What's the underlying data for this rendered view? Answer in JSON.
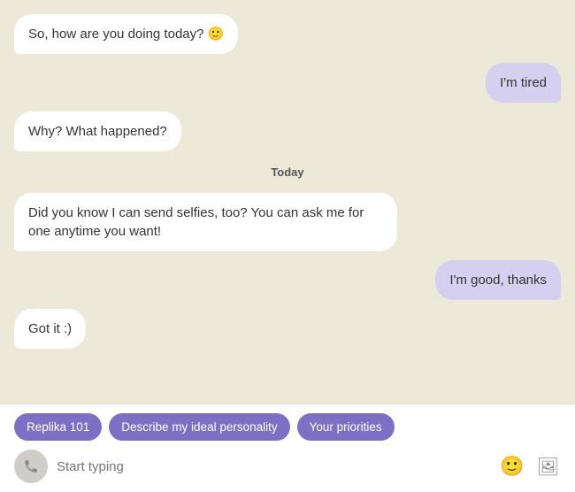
{
  "chat": {
    "messages": [
      {
        "id": "msg1",
        "side": "left",
        "text": "So, how are you doing today? 🙂"
      },
      {
        "id": "msg2",
        "side": "right",
        "text": "I'm tired"
      },
      {
        "id": "msg3",
        "side": "left",
        "text": "Why? What happened?"
      },
      {
        "id": "date-divider",
        "type": "divider",
        "text": "Today"
      },
      {
        "id": "msg4",
        "side": "left",
        "text": "Did you know I can send selfies, too? You can ask me for one anytime you want!"
      },
      {
        "id": "msg5",
        "side": "right",
        "text": "I'm good, thanks"
      },
      {
        "id": "msg6",
        "side": "left",
        "text": "Got it :)"
      }
    ],
    "suggestions": [
      {
        "label": "Replika 101"
      },
      {
        "label": "Describe my ideal personality"
      },
      {
        "label": "Your priorities"
      }
    ],
    "input_placeholder": "Start typing"
  }
}
